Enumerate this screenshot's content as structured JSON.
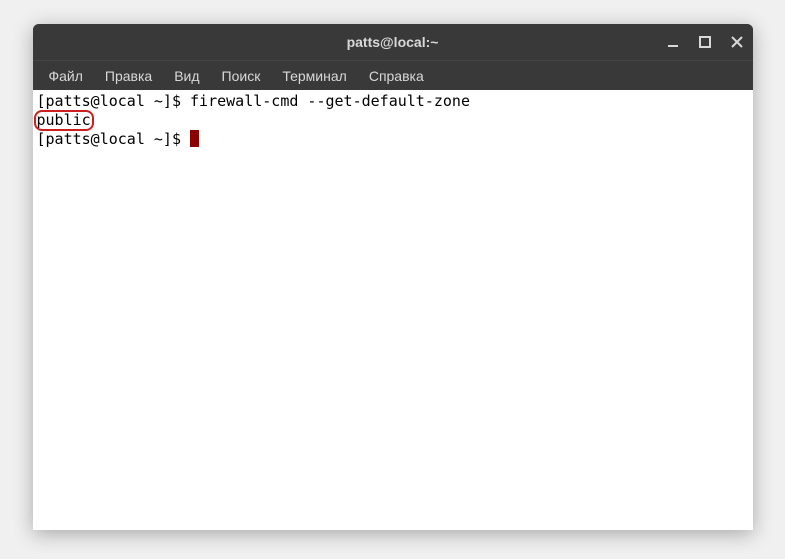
{
  "titlebar": {
    "title": "patts@local:~"
  },
  "menubar": {
    "items": [
      {
        "label": "Файл"
      },
      {
        "label": "Правка"
      },
      {
        "label": "Вид"
      },
      {
        "label": "Поиск"
      },
      {
        "label": "Терминал"
      },
      {
        "label": "Справка"
      }
    ]
  },
  "terminal": {
    "line1_prompt": "[patts@local ~]$ ",
    "line1_command": "firewall-cmd --get-default-zone",
    "line2_output": "public",
    "line3_prompt": "[patts@local ~]$ "
  }
}
